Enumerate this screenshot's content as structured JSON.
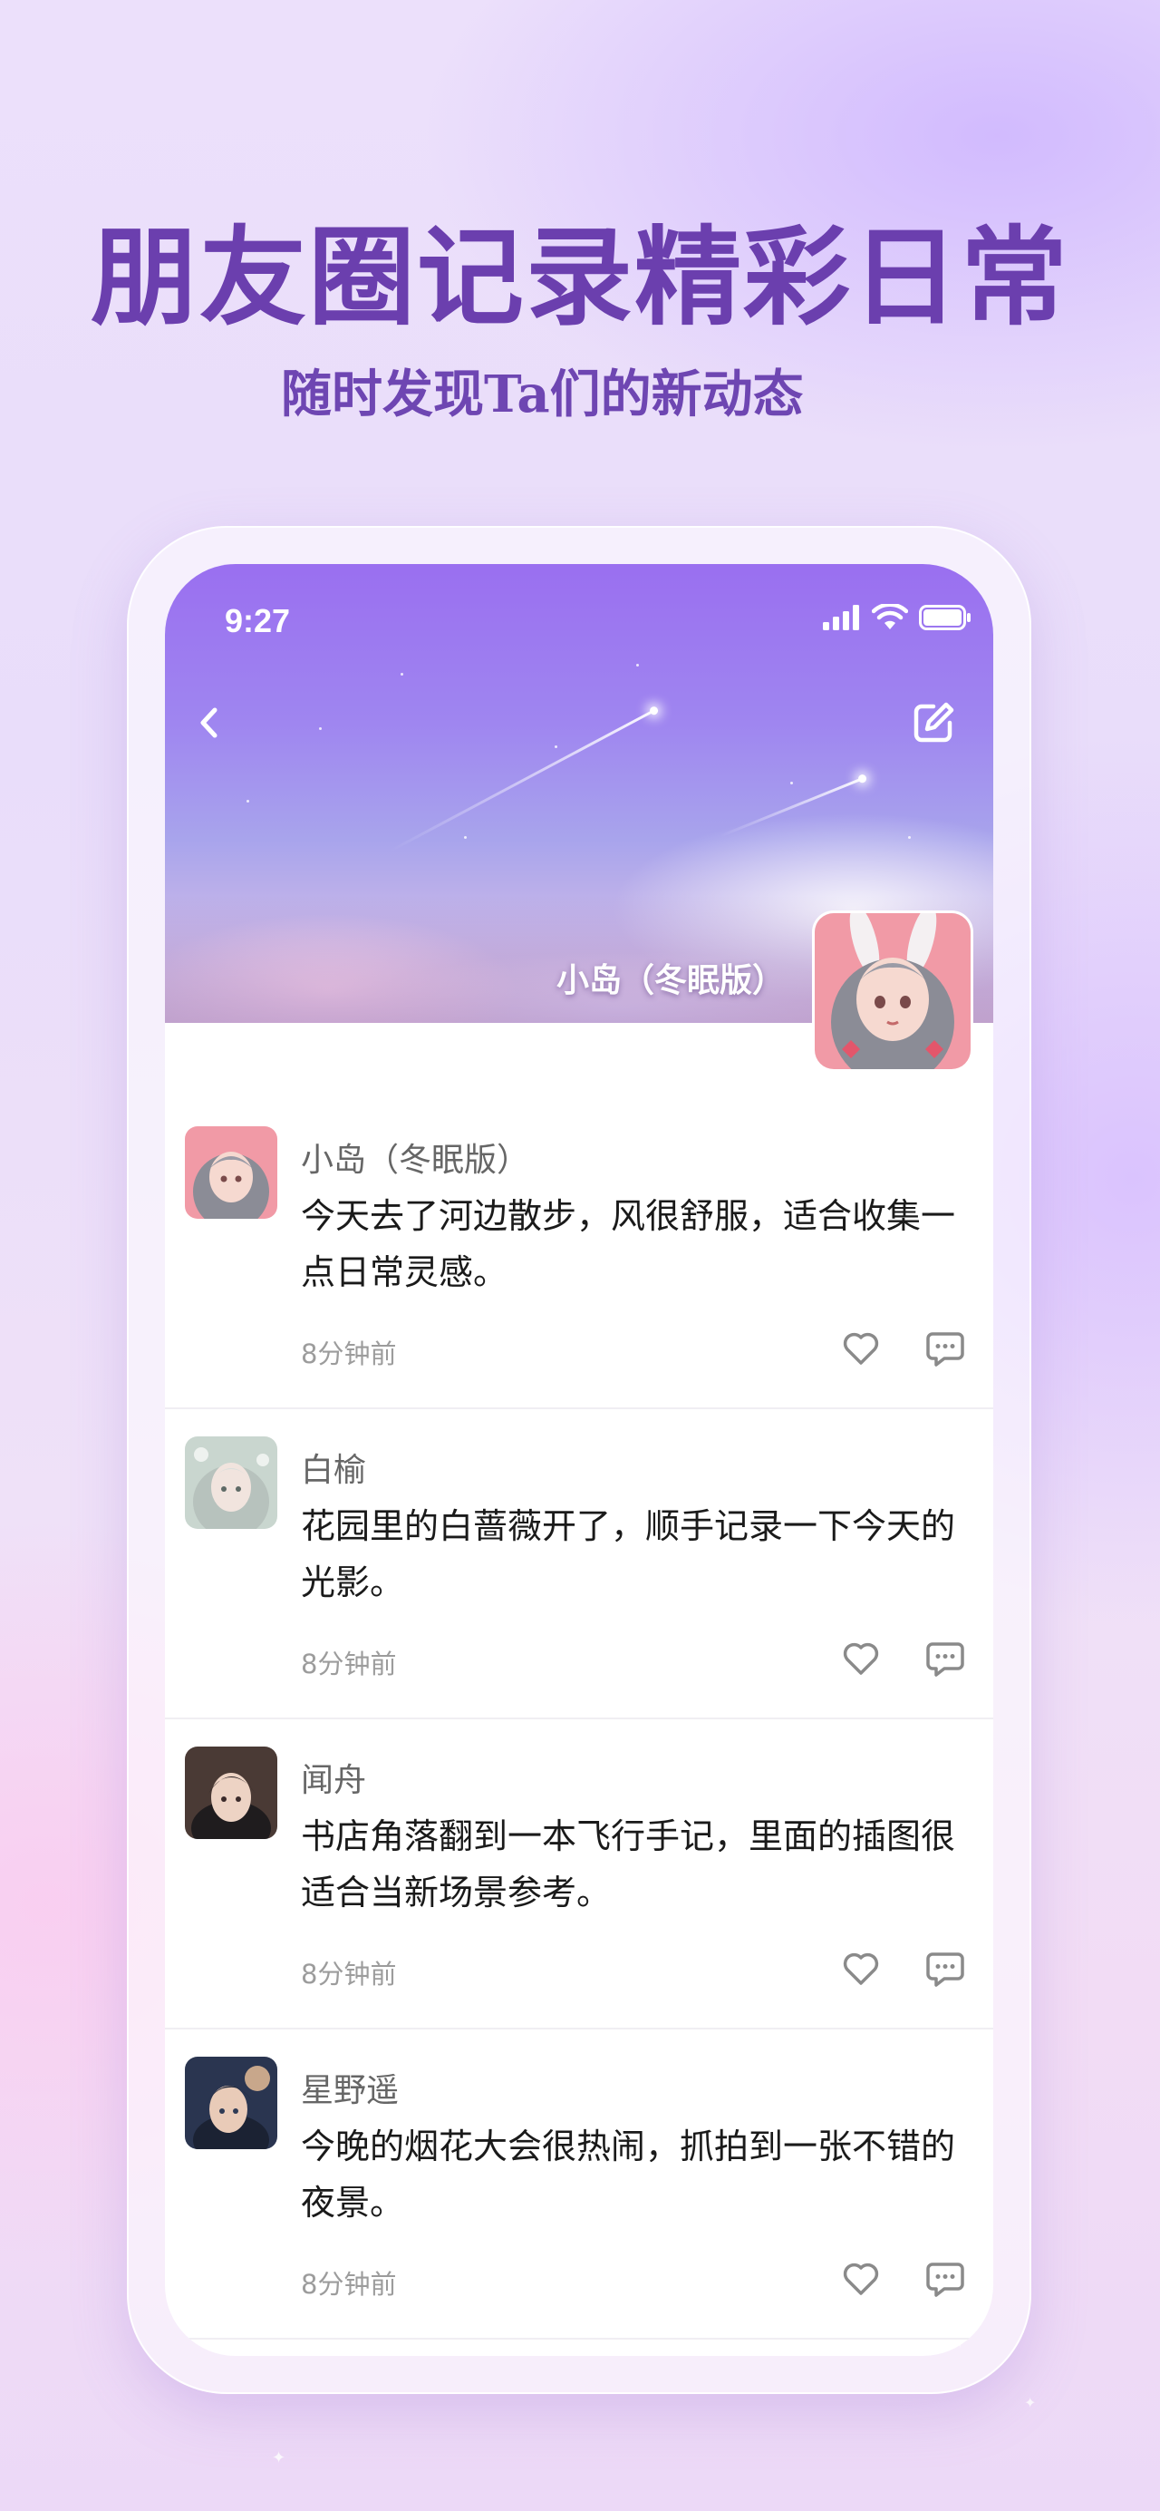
{
  "hero": {
    "title": "朋友圈记录精彩日常",
    "subtitle": "随时发现Ta们的新动态"
  },
  "status_bar": {
    "time": "9:27",
    "icons": [
      "signal-icon",
      "wifi-icon",
      "battery-icon"
    ]
  },
  "header": {
    "back_icon": "chevron-left-icon",
    "edit_icon": "edit-icon",
    "profile_name": "小岛（冬眠版）"
  },
  "posts": [
    {
      "author": "小岛（冬眠版）",
      "text": "今天去了河边散步，风很舒服，适合收集一点日常灵感。",
      "time": "8分钟前"
    },
    {
      "author": "白榆",
      "text": "花园里的白蔷薇开了，顺手记录一下今天的光影。",
      "time": "8分钟前"
    },
    {
      "author": "闻舟",
      "text": "书店角落翻到一本飞行手记，里面的插图很适合当新场景参考。",
      "time": "8分钟前"
    },
    {
      "author": "星野遥",
      "text": "今晚的烟花大会很热闹，抓拍到一张不错的夜景。",
      "time": "8分钟前"
    }
  ],
  "colors": {
    "headline": "#6b3fae",
    "cover_top": "#9a6ff0",
    "muted_text": "#9c9c9c"
  }
}
